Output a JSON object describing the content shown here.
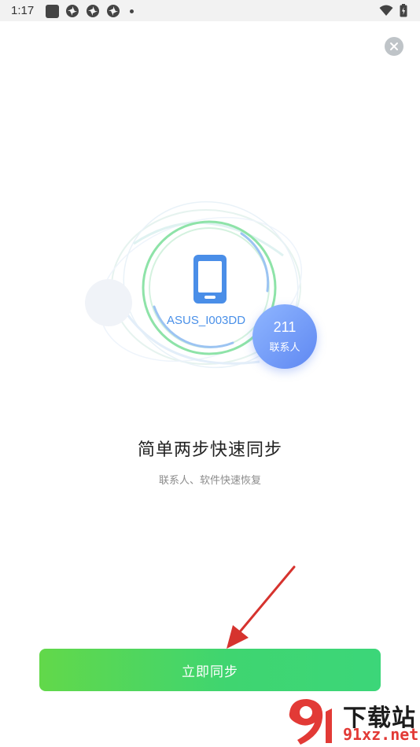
{
  "status_bar": {
    "time": "1:17"
  },
  "icons": {
    "close": "close-icon",
    "device": "phone-icon",
    "wifi": "wifi-icon",
    "battery": "battery-icon"
  },
  "hero": {
    "device_name": "ASUS_I003DD",
    "contact_count": "211",
    "contact_label": "联系人"
  },
  "main": {
    "headline": "简单两步快速同步",
    "subtitle": "联系人、软件快速恢复",
    "sync_button_label": "立即同步"
  },
  "watermark": {
    "title": "下载站",
    "url": "91xz.net"
  },
  "colors": {
    "accent_green": "#3fd570",
    "accent_blue": "#4a90e8",
    "arrow_red": "#d6332e"
  }
}
